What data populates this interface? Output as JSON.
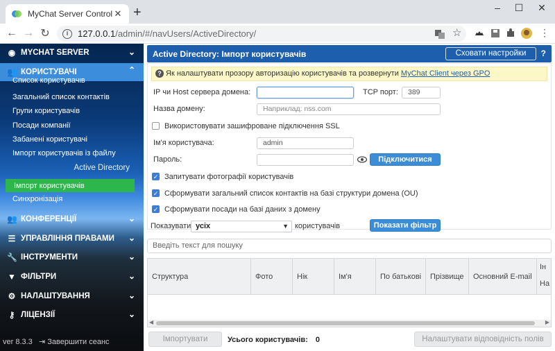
{
  "browser": {
    "tab_title": "MyChat Server Control Panel",
    "url_host": "127.0.0.1",
    "url_path": "/admin/#/navUsers/ActiveDirectory/"
  },
  "sidebar": {
    "header_server": "MYCHAT SERVER",
    "header_users": "КОРИСТУВАЧІ",
    "items": [
      "Список користувачів",
      "Загальний список контактів",
      "Групи користувачів",
      "Посади компанії",
      "Забанені користувачі",
      "Імпорт користувачів із файлу"
    ],
    "active_directory": "Active Directory",
    "import_users": "Імпорт користувачів",
    "sync": "Синхронізація",
    "sections": [
      "КОНФЕРЕНЦІЇ",
      "УПРАВЛІННЯ ПРАВАМИ",
      "ІНСТРУМЕНТИ",
      "ФІЛЬТРИ",
      "НАЛАШТУВАННЯ",
      "ЛІЦЕНЗІЇ"
    ],
    "version": "ver 8.3.3",
    "logout": "Завершити сеанс"
  },
  "main": {
    "title": "Active Directory: Імпорт користувачів",
    "hide_settings": "Сховати настройки",
    "help": "?",
    "notice_text": "Як налаштувати прозору авторизацію користувачів та розвернути ",
    "notice_link": "MyChat Client через GPO",
    "ip_label": "IP чи Host сервера домена:",
    "ip_value": "",
    "port_label": "TCP порт:",
    "port_value": "389",
    "domain_label": "Назва домену:",
    "domain_placeholder": "Наприклад: nss.com",
    "ssl_label": "Використовувати зашифроване підключення SSL",
    "username_label": "Ім'я користувача:",
    "username_value": "admin",
    "password_label": "Пароль:",
    "connect": "Підключитися",
    "photos_label": "Запитувати фотографії користувачів",
    "contacts_label": "Сформувати загальний список контактів на базі структури домена (OU)",
    "positions_label": "Сформувати посади на базі даних з домену",
    "show_label": "Показувати",
    "show_value": "усіх",
    "users_word": "користувачів",
    "show_filter": "Показати фільтр",
    "search_placeholder": "Введіть текст для пошуку",
    "columns": [
      "Структура",
      "Фото",
      "Нік",
      "Ім'я",
      "По батькові",
      "Прізвище",
      "Основний E-mail"
    ],
    "col_extra_top": "Ін",
    "col_extra_bottom": "На",
    "import_btn": "Імпортувати",
    "total_label": "Усього користувачів:",
    "total_value": "0",
    "fields_btn": "Налаштувати відповідність полів"
  }
}
